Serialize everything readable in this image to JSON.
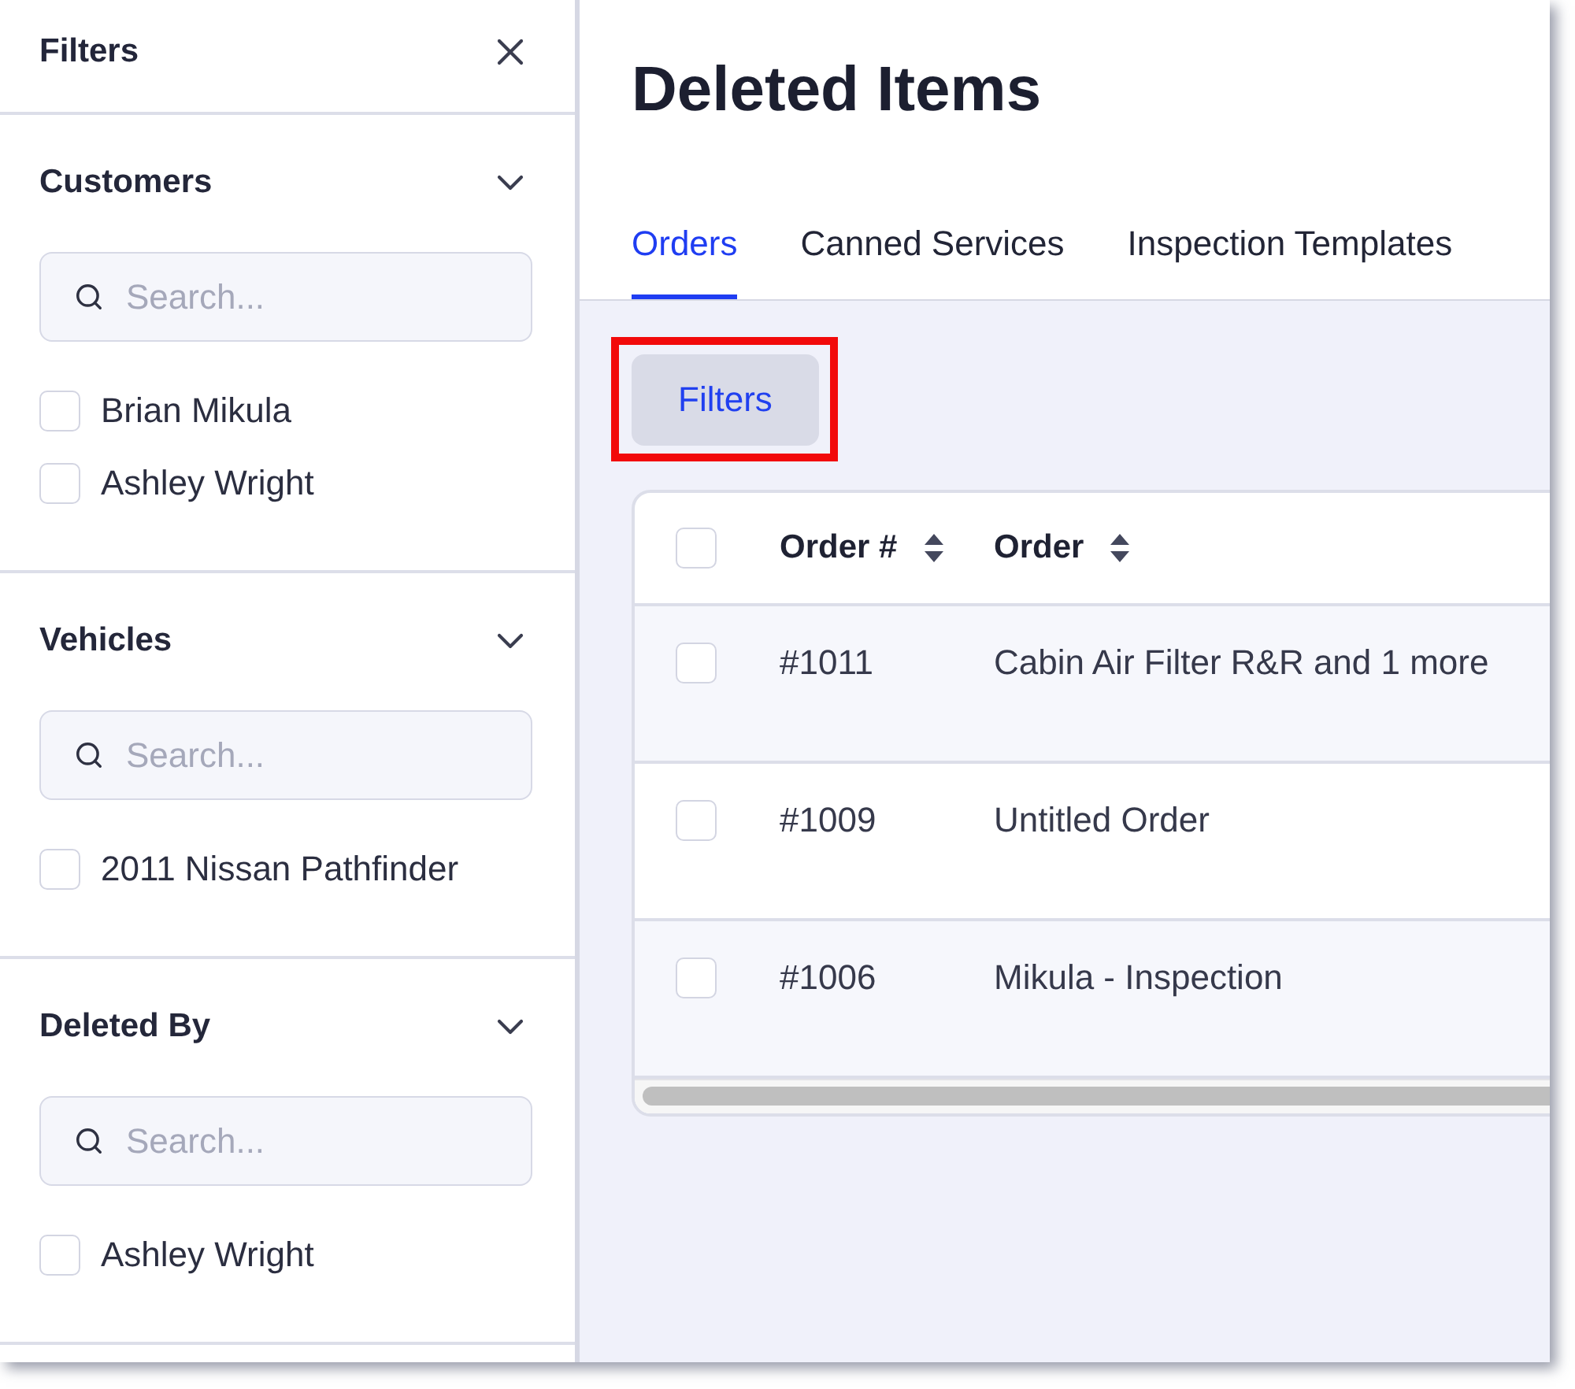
{
  "filters_panel": {
    "title": "Filters",
    "sections": [
      {
        "title": "Customers",
        "expanded": true,
        "search": {
          "placeholder": "Search..."
        },
        "options": [
          {
            "label": "Brian Mikula",
            "checked": false
          },
          {
            "label": "Ashley Wright",
            "checked": false
          }
        ]
      },
      {
        "title": "Vehicles",
        "expanded": true,
        "search": {
          "placeholder": "Search..."
        },
        "options": [
          {
            "label": "2011 Nissan Pathfinder",
            "checked": false
          }
        ]
      },
      {
        "title": "Deleted By",
        "expanded": true,
        "search": {
          "placeholder": "Search..."
        },
        "options": [
          {
            "label": "Ashley Wright",
            "checked": false
          }
        ]
      }
    ]
  },
  "page": {
    "title": "Deleted Items"
  },
  "tabs": [
    {
      "label": "Orders",
      "selected": true
    },
    {
      "label": "Canned Services",
      "selected": false
    },
    {
      "label": "Inspection Templates",
      "selected": false
    }
  ],
  "filters_button": {
    "label": "Filters",
    "highlighted": true
  },
  "table": {
    "select_all": {
      "checked": false
    },
    "columns": [
      {
        "label": "Order #",
        "sortable": true
      },
      {
        "label": "Order",
        "sortable": true
      }
    ],
    "rows": [
      {
        "checked": false,
        "cells": [
          "#1011",
          "Cabin Air Filter R&R and 1 more"
        ]
      },
      {
        "checked": false,
        "cells": [
          "#1009",
          "Untitled Order"
        ]
      },
      {
        "checked": false,
        "cells": [
          "#1006",
          "Mikula - Inspection"
        ]
      }
    ]
  }
}
